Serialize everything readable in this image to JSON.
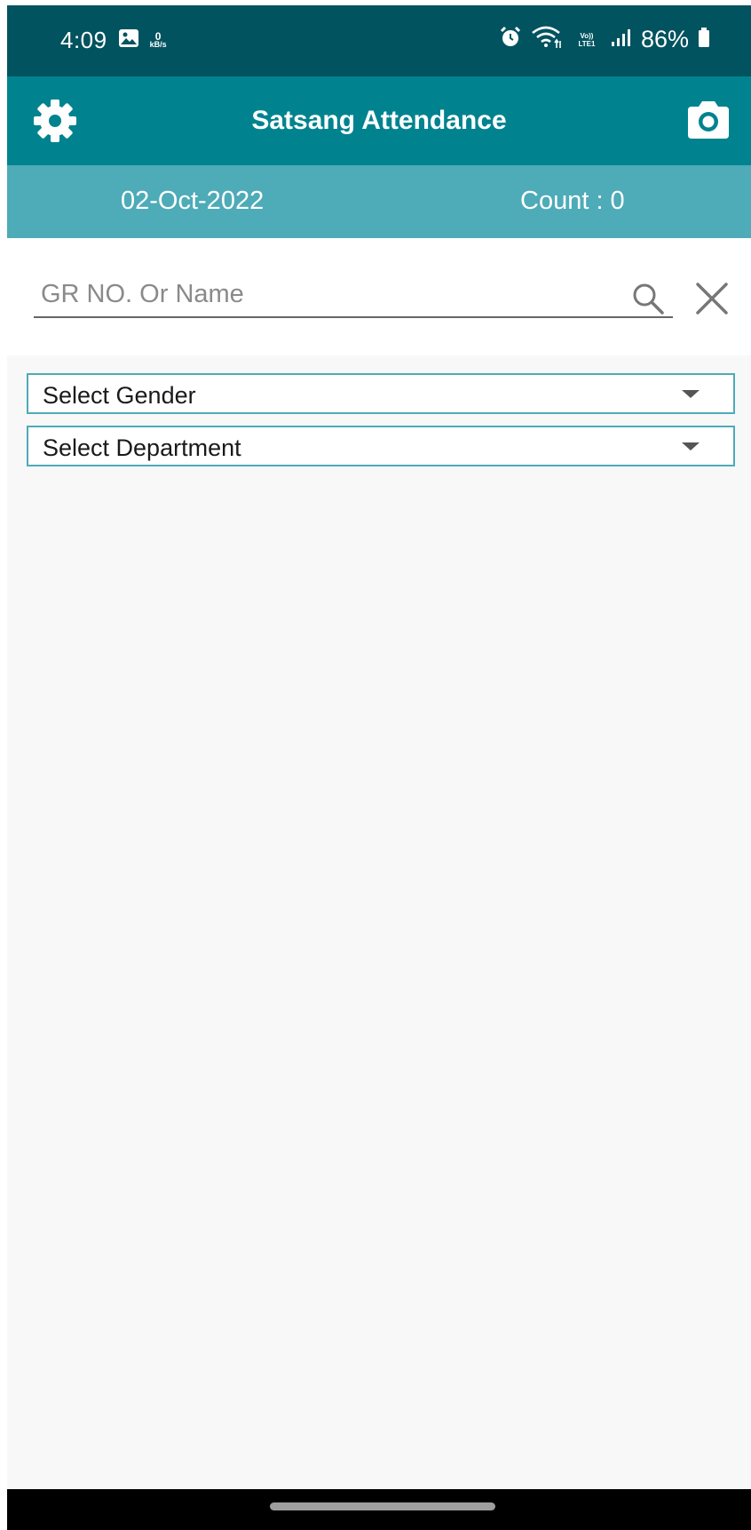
{
  "status_bar": {
    "time": "4:09",
    "net_speed_value": "0",
    "net_speed_unit": "kB/s",
    "network_label": "Vo)) LTE1",
    "battery": "86%",
    "icons": [
      "gallery-icon",
      "alarm-icon",
      "wifi-icon",
      "signal-icon",
      "battery-icon"
    ]
  },
  "app_bar": {
    "title": "Satsang Attendance",
    "settings_icon": "gear-icon",
    "camera_icon": "camera-icon"
  },
  "info_bar": {
    "date": "02-Oct-2022",
    "count": "Count : 0"
  },
  "search": {
    "value": "",
    "placeholder": "GR NO. Or Name",
    "search_icon": "search-icon",
    "clear_icon": "close-icon"
  },
  "filters": {
    "gender": {
      "selected": "Select Gender"
    },
    "department": {
      "selected": "Select Department"
    }
  },
  "colors": {
    "status_bar": "#00535f",
    "app_bar": "#00838f",
    "info_bar": "#4eabb8",
    "background": "#f8f8f8"
  }
}
